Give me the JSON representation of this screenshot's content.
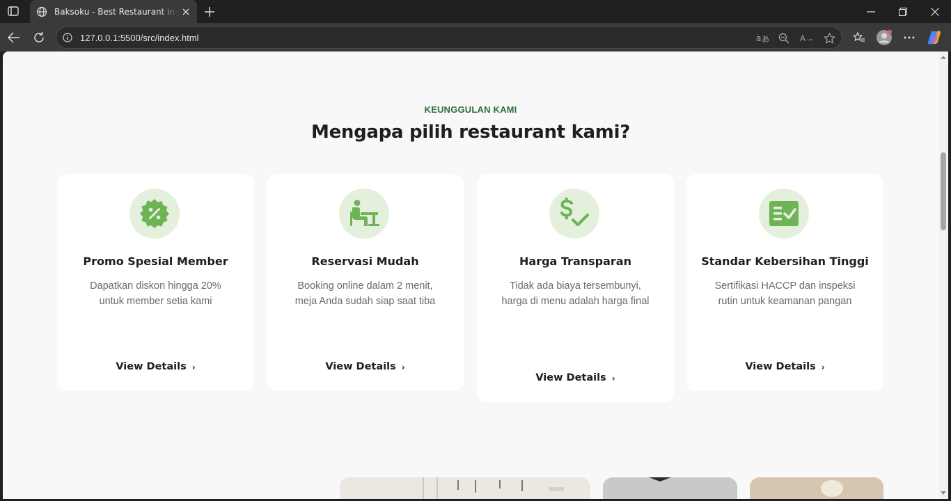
{
  "browser": {
    "tab_title": "Baksoku - Best Restaurant in Jakarta",
    "url": "127.0.0.1:5500/src/index.html",
    "read_aloud_label": "A→"
  },
  "section": {
    "tag": "KEUNGGULAN KAMI",
    "title": "Mengapa pilih restaurant kami?"
  },
  "cards": [
    {
      "icon": "discount-badge-icon",
      "title": "Promo Spesial Member",
      "desc": "Dapatkan diskon hingga 20% untuk member setia kami",
      "link": "View Details"
    },
    {
      "icon": "person-at-desk-icon",
      "title": "Reservasi Mudah",
      "desc": "Booking online dalam 2 menit, meja Anda sudah siap saat tiba",
      "link": "View Details"
    },
    {
      "icon": "dollar-check-icon",
      "title": "Harga Transparan",
      "desc": "Tidak ada biaya tersembunyi, harga di menu adalah harga final",
      "link": "View Details"
    },
    {
      "icon": "checklist-icon",
      "title": "Standar Kebersihan Tinggi",
      "desc": "Sertifikasi HACCP dan inspeksi rutin untuk keamanan pangan",
      "link": "View Details"
    }
  ],
  "colors": {
    "accent_green": "#2f6d39",
    "icon_green": "#6fb357",
    "icon_bg": "#e4f0dc",
    "page_bg": "#f8f8f8"
  }
}
